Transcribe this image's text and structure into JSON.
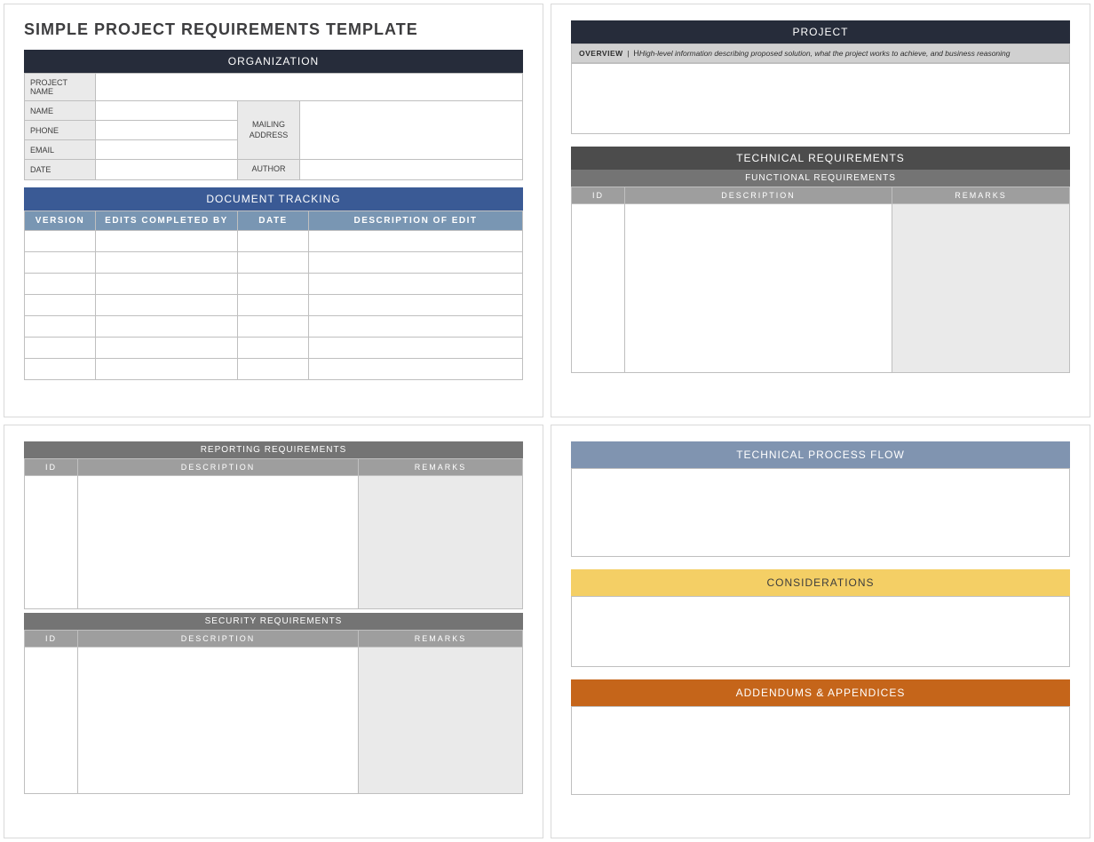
{
  "page_title": "SIMPLE PROJECT REQUIREMENTS TEMPLATE",
  "organization": {
    "header": "ORGANIZATION",
    "project_name_label": "PROJECT NAME",
    "name_label": "NAME",
    "phone_label": "PHONE",
    "email_label": "EMAIL",
    "date_label": "DATE",
    "mailing_address_label": "MAILING\nADDRESS",
    "author_label": "AUTHOR"
  },
  "tracking": {
    "header": "DOCUMENT TRACKING",
    "columns": {
      "version": "VERSION",
      "edits": "EDITS COMPLETED BY",
      "date": "DATE",
      "desc": "DESCRIPTION OF EDIT"
    }
  },
  "project": {
    "header": "PROJECT",
    "overview_label": "OVERVIEW",
    "overview_hint": "High-level information describing proposed solution, what the project works to achieve, and business reasoning",
    "tech_req_header": "TECHNICAL REQUIREMENTS",
    "func_req_header": "FUNCTIONAL REQUIREMENTS",
    "columns": {
      "id": "ID",
      "desc": "DESCRIPTION",
      "remarks": "REMARKS"
    }
  },
  "reporting": {
    "header": "REPORTING REQUIREMENTS",
    "security_header": "SECURITY REQUIREMENTS",
    "columns": {
      "id": "ID",
      "desc": "DESCRIPTION",
      "remarks": "REMARKS"
    }
  },
  "flow": {
    "header": "TECHNICAL PROCESS FLOW",
    "considerations_header": "CONSIDERATIONS",
    "addendums_header": "ADDENDUMS & APPENDICES"
  }
}
